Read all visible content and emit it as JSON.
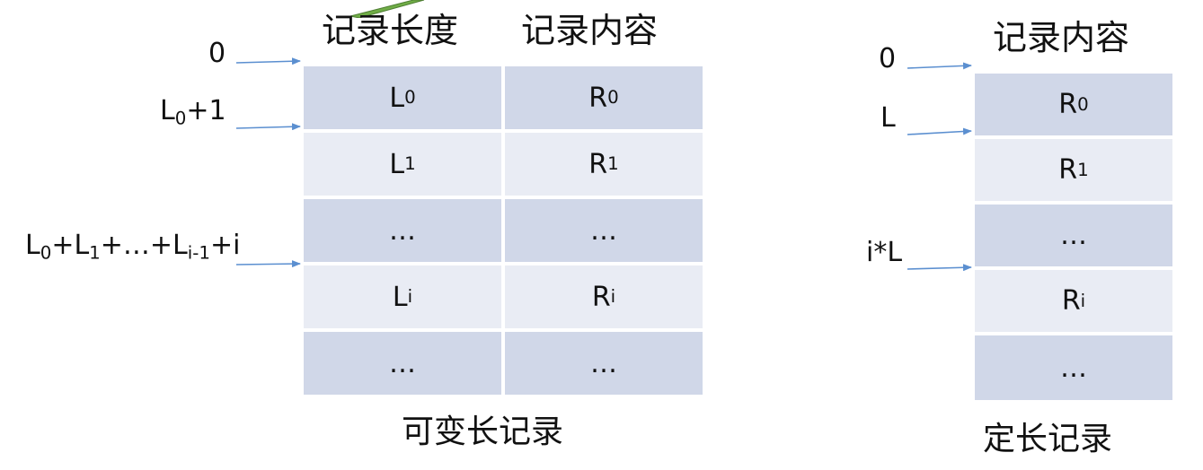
{
  "variable": {
    "header_length": "记录长度",
    "header_content": "记录内容",
    "caption": "可变长记录",
    "left_labels": [
      {
        "base": "0",
        "sub": "",
        "rest": ""
      },
      {
        "base": "L",
        "sub": "0",
        "rest": "+1"
      },
      {
        "base": "L",
        "sub": "0",
        "rest": "+L",
        "sub2": "1",
        "rest2": "+…+L",
        "sub3": "i-1",
        "rest3": "+i"
      }
    ],
    "rows": [
      {
        "len_base": "L",
        "len_sub": "0",
        "rec_base": "R",
        "rec_sub": "0"
      },
      {
        "len_base": "L",
        "len_sub": "1",
        "rec_base": "R",
        "rec_sub": "1"
      },
      {
        "len_base": "…",
        "len_sub": "",
        "rec_base": "…",
        "rec_sub": ""
      },
      {
        "len_base": "L",
        "len_sub": "i",
        "rec_base": "R",
        "rec_sub": "i"
      },
      {
        "len_base": "…",
        "len_sub": "",
        "rec_base": "…",
        "rec_sub": ""
      }
    ]
  },
  "fixed": {
    "header_content": "记录内容",
    "caption": "定长记录",
    "left_labels": [
      "0",
      "L",
      "i*L"
    ],
    "rows": [
      {
        "base": "R",
        "sub": "0"
      },
      {
        "base": "R",
        "sub": "1"
      },
      {
        "base": "…",
        "sub": ""
      },
      {
        "base": "R",
        "sub": "i"
      },
      {
        "base": "…",
        "sub": ""
      }
    ]
  },
  "colors": {
    "row_dark": "#d0d7e8",
    "row_light": "#e9ecf4",
    "arrow": "#5b8fd0",
    "accent_shape": "#70ad47"
  }
}
